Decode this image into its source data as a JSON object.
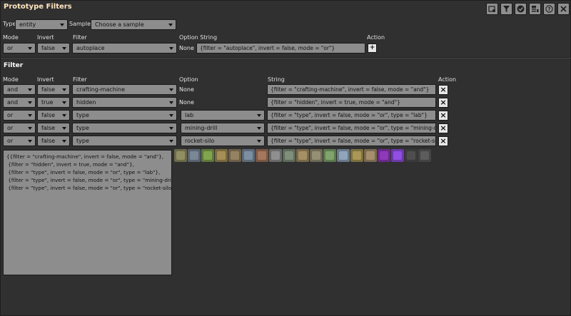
{
  "window": {
    "title": "Prototype Filters"
  },
  "titlebar_icons": [
    "prototype-browser-icon",
    "filter-icon",
    "checkmark-icon",
    "export-icon",
    "help-icon",
    "close-icon"
  ],
  "top": {
    "type_label": "Type",
    "type_value": "entity",
    "sample_label": "Sample",
    "sample_value": "Choose a sample",
    "headers": {
      "mode": "Mode",
      "invert": "Invert",
      "filter": "Filter",
      "option_string": "Option String",
      "action": "Action"
    },
    "row": {
      "mode": "or",
      "invert": "false",
      "filter": "autoplace",
      "option": "None",
      "string": "{filter = \"autoplace\", invert = false, mode = \"or\"}",
      "action": "+"
    }
  },
  "filter_section": {
    "title": "Filter",
    "headers": {
      "mode": "Mode",
      "invert": "Invert",
      "filter": "Filter",
      "option": "Option",
      "string": "String",
      "action": "Action"
    },
    "rows": [
      {
        "mode": "and",
        "invert": "false",
        "filter": "crafting-machine",
        "option": "None",
        "string": "{filter = \"crafting-machine\", invert = false, mode = \"and\"}"
      },
      {
        "mode": "and",
        "invert": "true",
        "filter": "hidden",
        "option": "None",
        "string": "{filter = \"hidden\", invert = true, mode = \"and\"}"
      },
      {
        "mode": "or",
        "invert": "false",
        "filter": "type",
        "option": "lab",
        "string": "{filter = \"type\", invert = false, mode = \"or\", type = \"lab\"}"
      },
      {
        "mode": "or",
        "invert": "false",
        "filter": "type",
        "option": "mining-drill",
        "string": "{filter = \"type\", invert = false, mode = \"or\", type = \"mining-drill\"}"
      },
      {
        "mode": "or",
        "invert": "false",
        "filter": "type",
        "option": "rocket-silo",
        "string": "{filter = \"type\", invert = false, mode = \"or\", type = \"rocket-silo\"}"
      }
    ],
    "action_label": "×"
  },
  "output": {
    "text": "{{filter = \"crafting-machine\", invert = false, mode = \"and\"},\n {filter = \"hidden\", invert = true, mode = \"and\"},\n {filter = \"type\", invert = false, mode = \"or\", type = \"lab\"},\n {filter = \"type\", invert = false, mode = \"or\", type = \"mining-drill\"},\n {filter = \"type\", invert = false, mode = \"or\", type = \"rocket-silo\"}}"
  },
  "result_icons": [
    {
      "name": "assembling-machine-1-icon",
      "color": "#6b6a4a"
    },
    {
      "name": "assembling-machine-2-icon",
      "color": "#5a6470"
    },
    {
      "name": "assembling-machine-3-icon",
      "color": "#5f7a3a"
    },
    {
      "name": "burner-mining-drill-icon",
      "color": "#7a6a40"
    },
    {
      "name": "chemical-plant-icon",
      "color": "#6e6048"
    },
    {
      "name": "centrifuge-icon",
      "color": "#5c6a78"
    },
    {
      "name": "oil-refinery-icon",
      "color": "#7a5844"
    },
    {
      "name": "electric-furnace-icon",
      "color": "#6a6a6a"
    },
    {
      "name": "electric-mining-drill-icon",
      "color": "#5e6a5a"
    },
    {
      "name": "lab-icon",
      "color": "#7a6a4a"
    },
    {
      "name": "pumpjack-icon",
      "color": "#6e6a56"
    },
    {
      "name": "rocket-silo-icon",
      "color": "#5e7a50"
    },
    {
      "name": "steel-furnace-icon",
      "color": "#6a7a8a"
    },
    {
      "name": "stone-furnace-icon",
      "color": "#7e7040"
    },
    {
      "name": "recycler-icon",
      "color": "#7a6a50"
    },
    {
      "name": "biochamber-icon",
      "color": "#6a2a8a"
    },
    {
      "name": "biolab-icon",
      "color": "#6b3aa8"
    },
    {
      "name": "foundry-icon",
      "color": "#3a3a3a"
    },
    {
      "name": "cryogenic-plant-icon",
      "color": "#444444"
    }
  ]
}
